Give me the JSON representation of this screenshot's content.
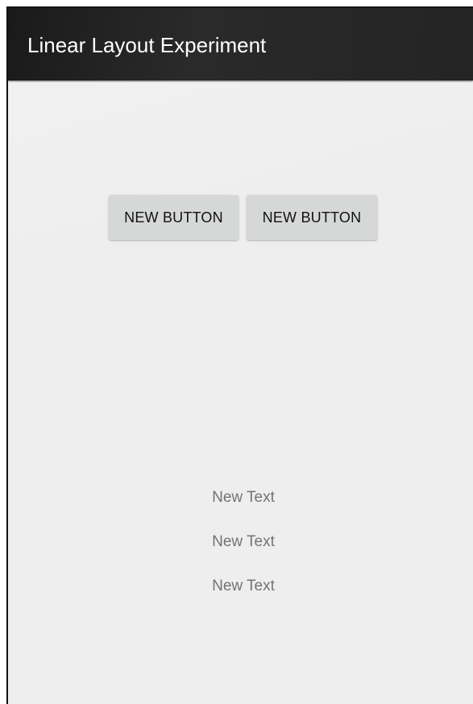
{
  "action_bar": {
    "title": "Linear Layout Experiment"
  },
  "buttons": [
    {
      "label": "NEW BUTTON"
    },
    {
      "label": "NEW BUTTON"
    }
  ],
  "texts": [
    {
      "value": "New Text"
    },
    {
      "value": "New Text"
    },
    {
      "value": "New Text"
    }
  ],
  "colors": {
    "action_bar": "#222222",
    "background": "#eeeeee",
    "button": "#d6d7d7",
    "text": "#737373"
  }
}
